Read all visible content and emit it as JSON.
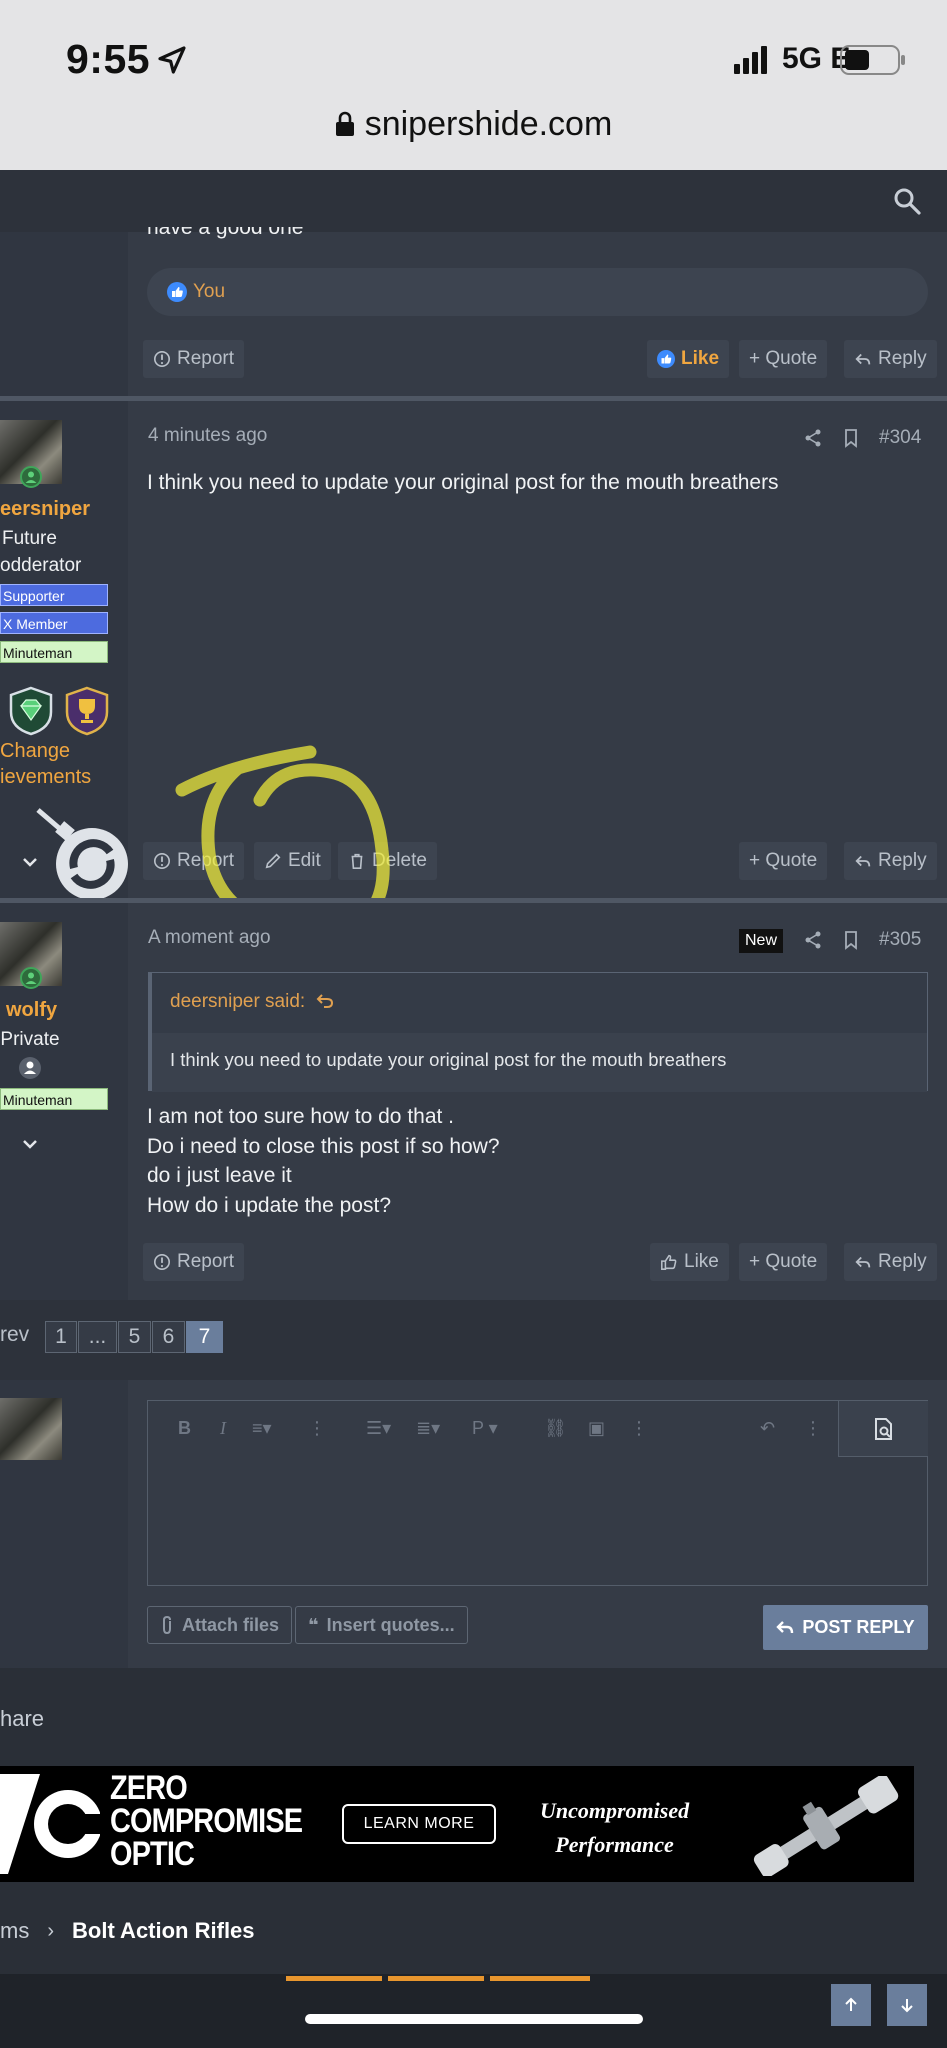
{
  "status_bar": {
    "time": "9:55",
    "network": "5G E"
  },
  "browser": {
    "url": "snipershide.com"
  },
  "post_prev": {
    "partial_text": "have a good one",
    "reaction_label": "You",
    "actions": {
      "report": "Report",
      "like": "Like",
      "quote": "+ Quote",
      "reply": "Reply"
    }
  },
  "post_304": {
    "user": {
      "name": "eersniper",
      "title_line1": "Future",
      "title_line2": "odderator",
      "banners": [
        "Supporter",
        "X Member",
        "Minuteman"
      ],
      "achievements_line1": "Change",
      "achievements_line2": "ievements"
    },
    "time": "4 minutes ago",
    "number": "#304",
    "text": "I think you need to update your original post for the mouth breathers",
    "actions": {
      "report": "Report",
      "edit": "Edit",
      "delete": "Delete",
      "quote": "+ Quote",
      "reply": "Reply"
    }
  },
  "post_305": {
    "user": {
      "name": "wolfy",
      "title": "Private",
      "banners": [
        "Minuteman"
      ]
    },
    "time": "A moment ago",
    "new_badge": "New",
    "number": "#305",
    "quote": {
      "author": "deersniper said:",
      "text": "I think you need to update your original post for the mouth breathers"
    },
    "lines": [
      "I am not too sure how to do that .",
      "Do i need to close this post if so how?",
      "do i just leave it",
      "How do i update the post?"
    ],
    "actions": {
      "report": "Report",
      "like": "Like",
      "quote": "+ Quote",
      "reply": "Reply"
    }
  },
  "pagination": {
    "prev": "rev",
    "pages": [
      "1",
      "...",
      "5",
      "6",
      "7"
    ],
    "current": "7"
  },
  "editor": {
    "attach": "Attach files",
    "insert_quotes": "Insert quotes...",
    "post_reply": "POST REPLY"
  },
  "share_label": "hare",
  "ad": {
    "brand_line1": "ZERO",
    "brand_line2": "COMPROMISE",
    "brand_line3": "OPTIC",
    "cta": "LEARN MORE",
    "tagline_line1": "Uncompromised",
    "tagline_line2": "Performance"
  },
  "breadcrumb": {
    "prev": "ms",
    "current": "Bolt Action Rifles"
  },
  "colors": {
    "accent": "#f0a640",
    "page_bg": "#2a2f37",
    "button_blue": "#6a7e9c"
  }
}
